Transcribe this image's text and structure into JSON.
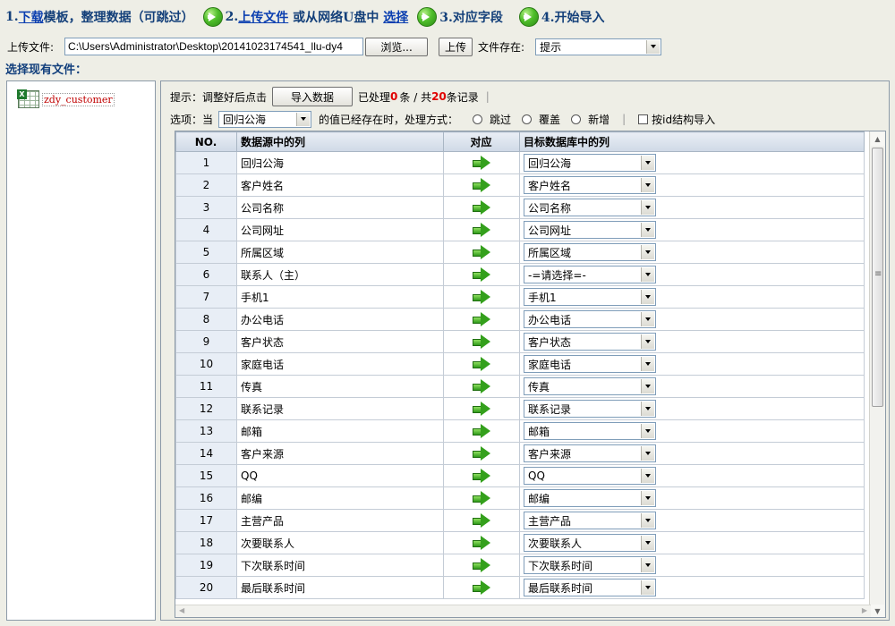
{
  "steps": {
    "step1_prefix": "1.",
    "step1_link": "下载",
    "step1_text": " 模板，整理数据（可跳过）",
    "step2_prefix": "2.",
    "step2_link": "上传文件",
    "step2_text": " 或从网络U盘中 ",
    "step2_link2": "选择",
    "step3": "3.对应字段",
    "step4": "4.开始导入"
  },
  "upload": {
    "label": "上传文件:",
    "file_path": "C:\\Users\\Administrator\\Desktop\\20141023174541_llu-dy4",
    "browse_label": "浏览...",
    "upload_label": "上传",
    "exist_label": "文件存在:",
    "exist_value": "提示"
  },
  "existing": {
    "label": "选择现有文件：",
    "file_name": "zdy_customer"
  },
  "hint": {
    "prefix": "提示：调整好后点击",
    "import_button": "导入数据",
    "processed_label": "已处理",
    "processed_count": "0",
    "processed_unit": "条 / 共",
    "total_count": "20",
    "total_unit": "条记录",
    "sep": "|"
  },
  "options": {
    "label": "选项：当",
    "field_value": "回归公海",
    "suffix": "的值已经存在时，处理方式：",
    "skip": "跳过",
    "overwrite": "覆盖",
    "add": "新增",
    "sep": "|",
    "id_struct": "按id结构导入"
  },
  "table": {
    "headers": [
      "NO.",
      "数据源中的列",
      "对应",
      "目标数据库中的列"
    ],
    "rows": [
      {
        "no": "1",
        "src": "回归公海",
        "target": "回归公海"
      },
      {
        "no": "2",
        "src": "客户姓名",
        "target": "客户姓名"
      },
      {
        "no": "3",
        "src": "公司名称",
        "target": "公司名称"
      },
      {
        "no": "4",
        "src": "公司网址",
        "target": "公司网址"
      },
      {
        "no": "5",
        "src": "所属区域",
        "target": "所属区域"
      },
      {
        "no": "6",
        "src": "联系人（主）",
        "target": "-=请选择=-"
      },
      {
        "no": "7",
        "src": "手机1",
        "target": "手机1"
      },
      {
        "no": "8",
        "src": "办公电话",
        "target": "办公电话"
      },
      {
        "no": "9",
        "src": "客户状态",
        "target": "客户状态"
      },
      {
        "no": "10",
        "src": "家庭电话",
        "target": "家庭电话"
      },
      {
        "no": "11",
        "src": "传真",
        "target": "传真"
      },
      {
        "no": "12",
        "src": "联系记录",
        "target": "联系记录"
      },
      {
        "no": "13",
        "src": "邮箱",
        "target": "邮箱"
      },
      {
        "no": "14",
        "src": "客户来源",
        "target": "客户来源"
      },
      {
        "no": "15",
        "src": "QQ",
        "target": "QQ"
      },
      {
        "no": "16",
        "src": "邮编",
        "target": "邮编"
      },
      {
        "no": "17",
        "src": "主营产品",
        "target": "主营产品"
      },
      {
        "no": "18",
        "src": "次要联系人",
        "target": "次要联系人"
      },
      {
        "no": "19",
        "src": "下次联系时间",
        "target": "下次联系时间"
      },
      {
        "no": "20",
        "src": "最后联系时间",
        "target": "最后联系时间"
      }
    ]
  },
  "icons": {
    "step_arrow": "green-circle-arrow-icon",
    "map_arrow": "green-right-arrow-icon",
    "file": "excel-file-icon"
  },
  "colors": {
    "link": "#0b3fb0",
    "heading": "#14407a",
    "count": "#e00000",
    "file_name": "#c00000"
  }
}
